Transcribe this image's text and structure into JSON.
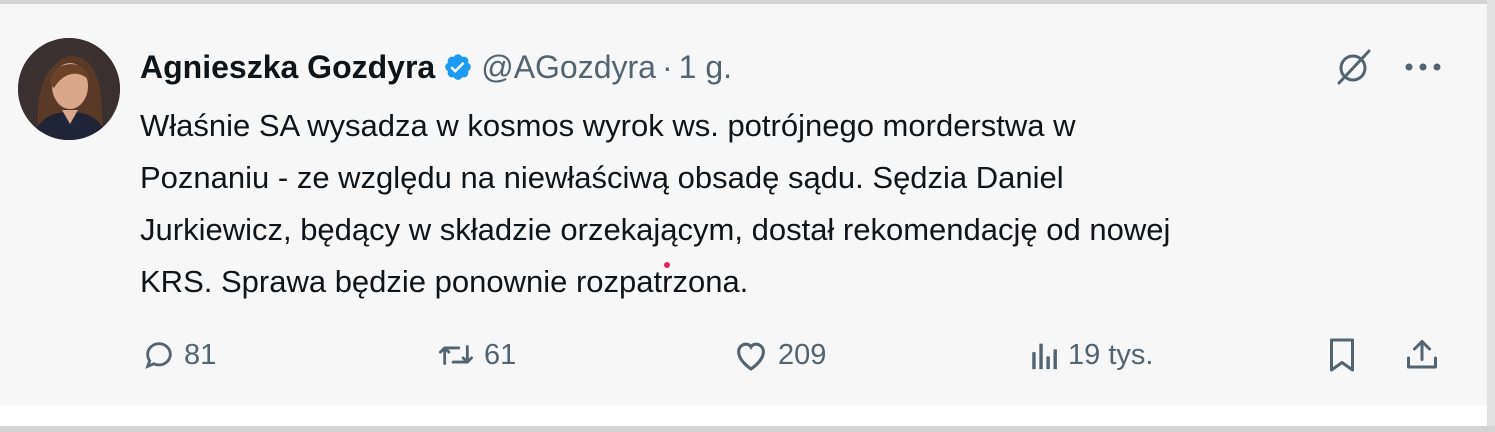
{
  "tweet": {
    "author_name": "Agnieszka Gozdyra",
    "handle": "@AGozdyra",
    "separator": "·",
    "time": "1 g.",
    "text_lines": [
      "Właśnie SA wysadza w kosmos wyrok ws. potrójnego morderstwa w",
      "Poznaniu - ze względu na niewłaściwą obsadę sądu. Sędzia Daniel",
      "Jurkiewicz, będący w składzie orzekającym, dostał rekomendację od nowej",
      "KRS. Sprawa będzie ponownie rozpatrzona."
    ]
  },
  "actions": {
    "replies": "81",
    "reposts": "61",
    "likes": "209",
    "views": "19 tys."
  },
  "icons": {
    "verified": "verified-badge-icon",
    "grok": "grok-icon",
    "more": "more-icon",
    "reply": "reply-icon",
    "repost": "repost-icon",
    "like": "like-icon",
    "views": "views-icon",
    "bookmark": "bookmark-icon",
    "share": "share-icon"
  },
  "colors": {
    "verified": "#1d9bf0",
    "text": "#0f1419",
    "secondary": "#536471",
    "background": "#f7f7f7"
  }
}
